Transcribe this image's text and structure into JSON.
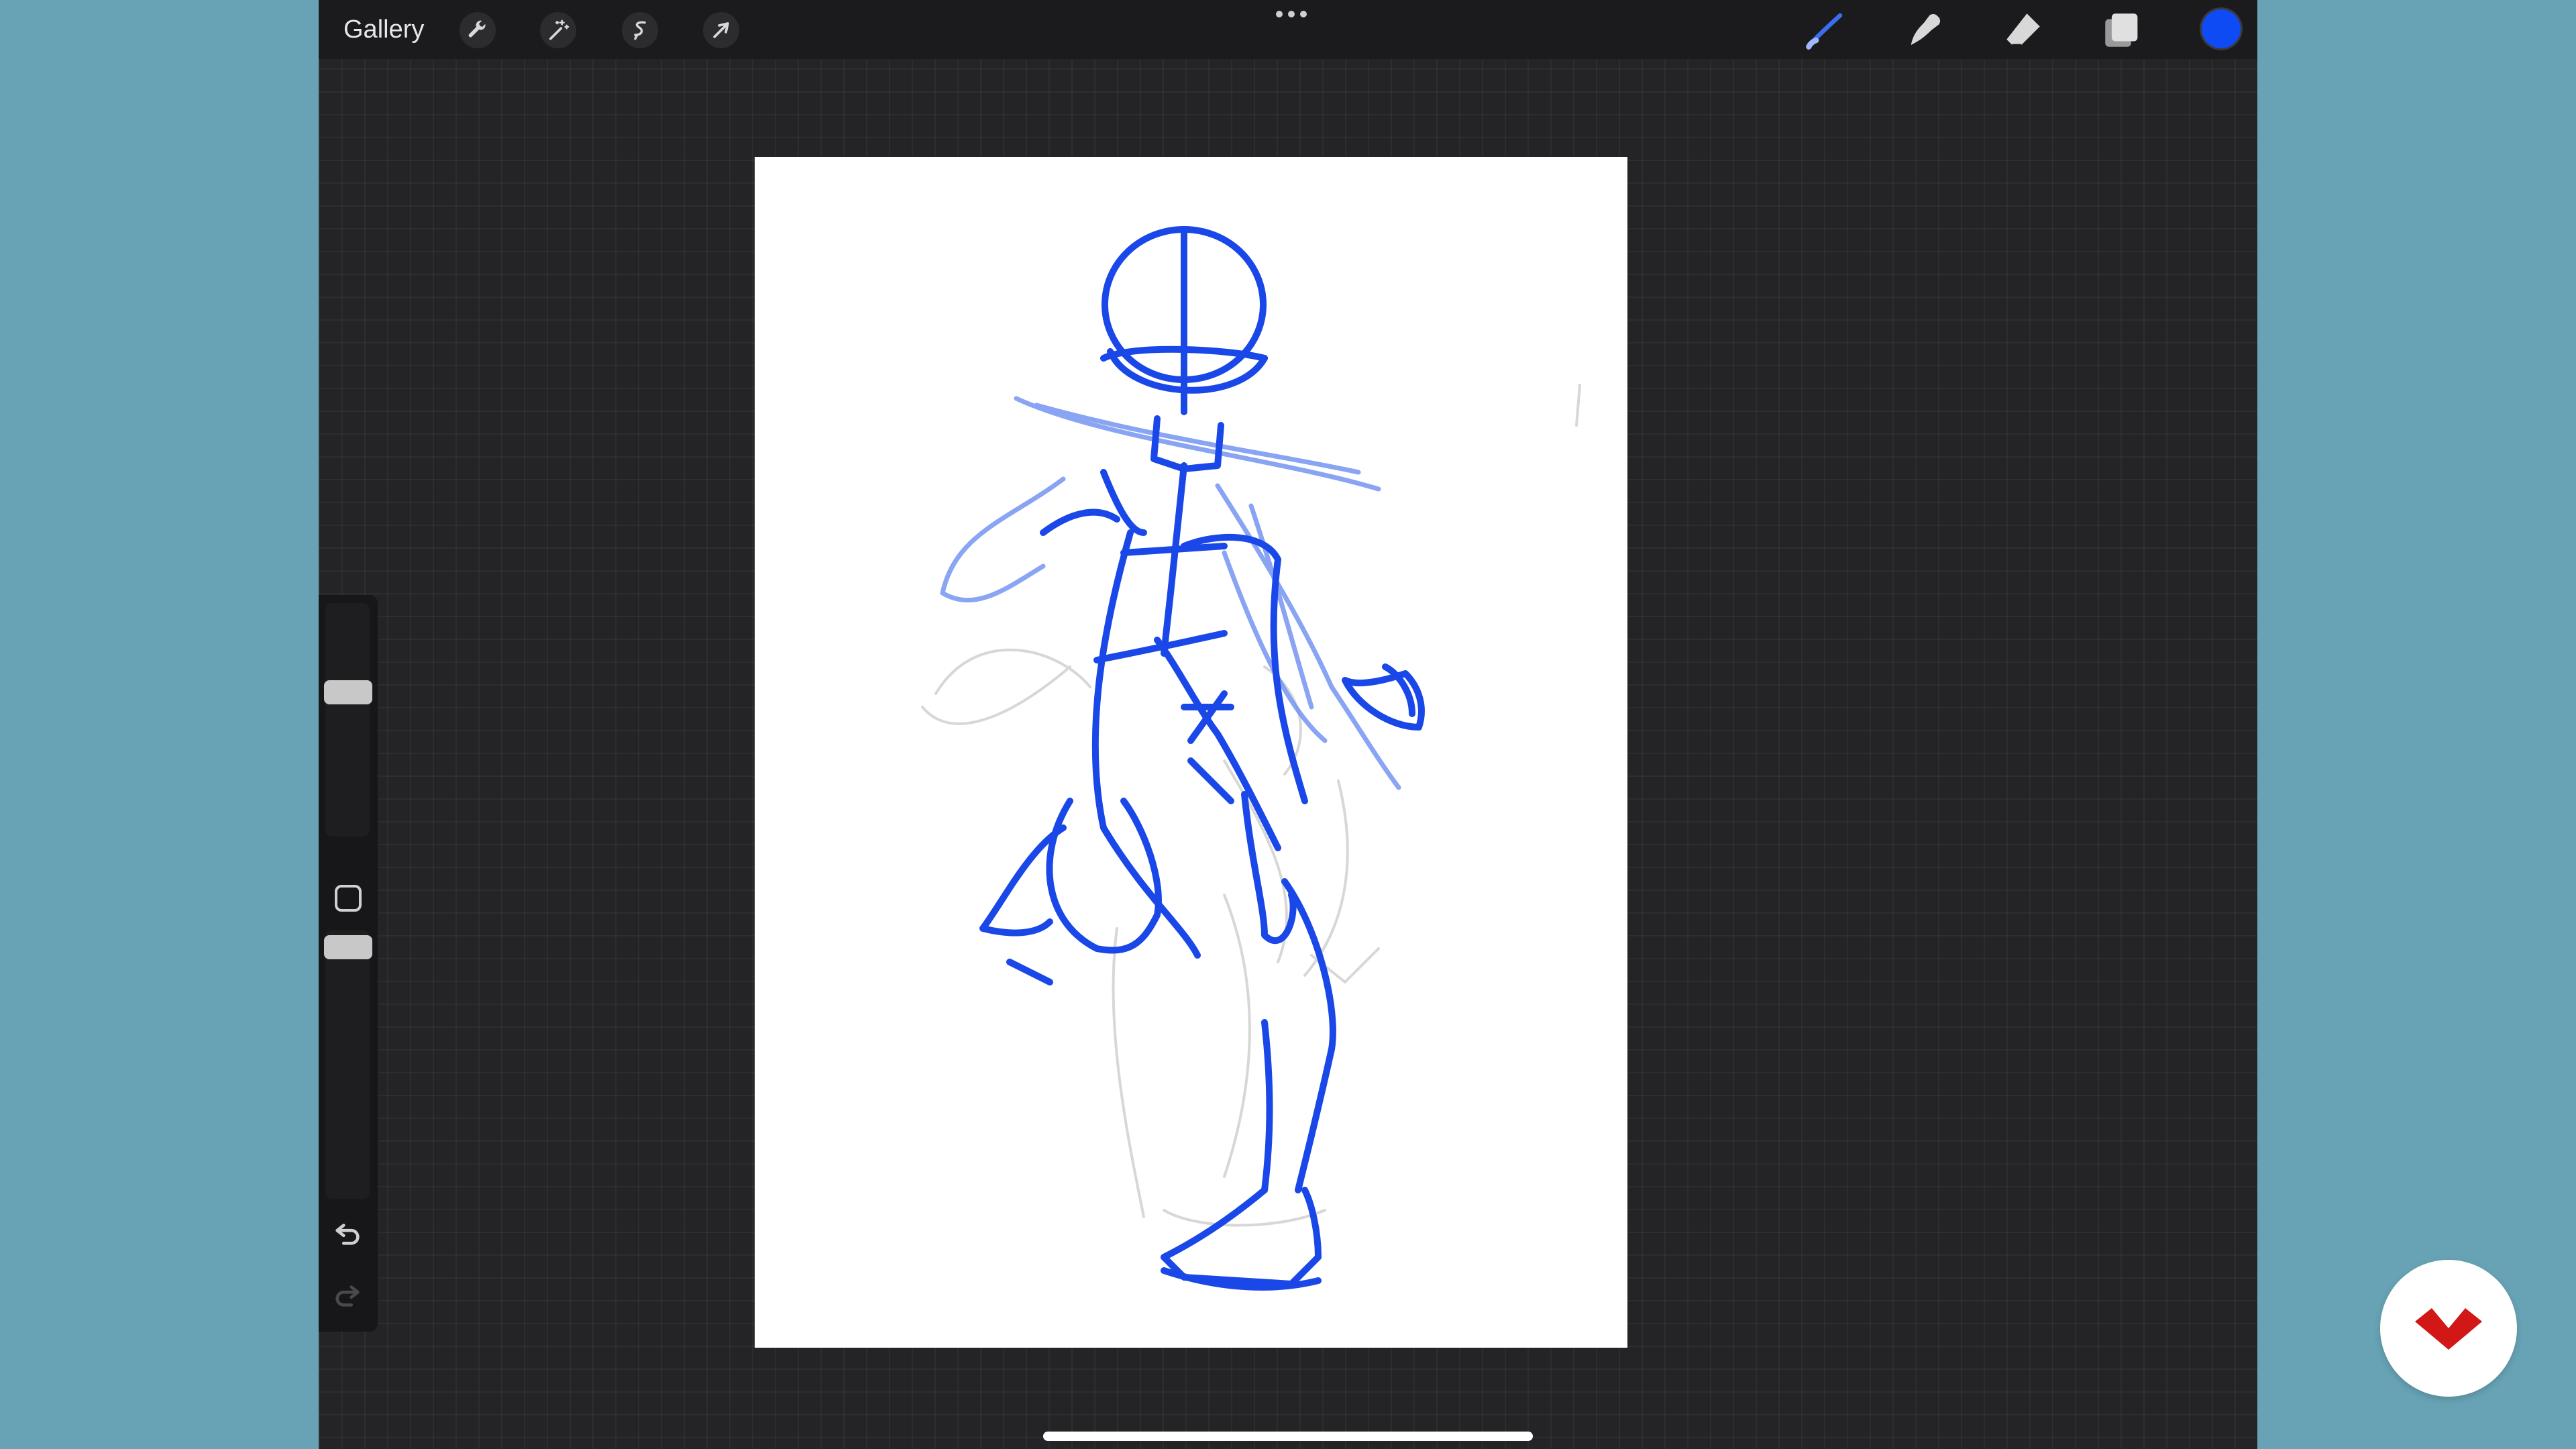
{
  "app": {
    "toolbar_left": {
      "gallery_label": "Gallery",
      "tools": [
        {
          "icon": "wrench-icon"
        },
        {
          "icon": "magic-wand-icon"
        },
        {
          "icon": "selection-s-icon"
        },
        {
          "icon": "arrow-transform-icon"
        }
      ]
    },
    "toolbar_right": {
      "tools": [
        {
          "icon": "brush-icon"
        },
        {
          "icon": "smudge-icon"
        },
        {
          "icon": "eraser-icon"
        },
        {
          "icon": "layers-icon"
        }
      ],
      "current_color": "#0f4bf5"
    },
    "sidebar": {
      "brush_size_level": 0.63,
      "opacity_level": 0.98
    },
    "canvas": {
      "background": "#ffffff",
      "sketch_color": "#1a47e8"
    }
  },
  "brand": {
    "logo_color": "#d21717"
  }
}
